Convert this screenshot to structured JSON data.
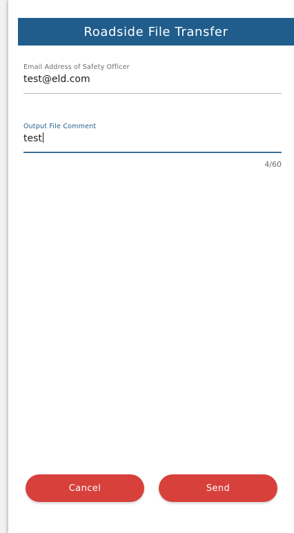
{
  "header": {
    "title": "Roadside File Transfer"
  },
  "email_field": {
    "label": "Email Address of Safety Officer",
    "value": "test@eld.com"
  },
  "comment_field": {
    "label": "Output File Comment",
    "value": "test",
    "counter": "4/60"
  },
  "buttons": {
    "cancel_label": "Cancel",
    "send_label": "Send"
  },
  "colors": {
    "header_bg": "#205d8c",
    "accent": "#3a6f99",
    "button_bg": "#d8403b"
  }
}
